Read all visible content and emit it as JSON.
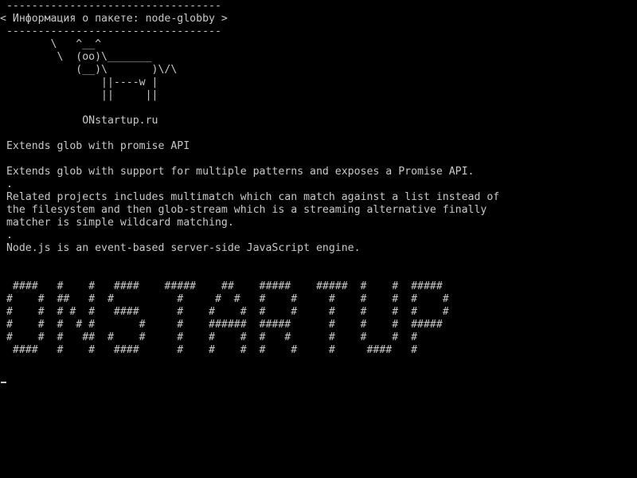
{
  "terminal": {
    "background": "#000000",
    "foreground": "#c8c8c8",
    "lines": [
      " ----------------------------------",
      "< Информация о пакете: node-globby >",
      " ----------------------------------",
      "        \\   ^__^",
      "         \\  (oo)\\_______",
      "            (__)\\       )\\/\\",
      "                ||----w |",
      "                ||     ||",
      "",
      "             ONstartup.ru",
      "",
      " Extends glob with promise API",
      "",
      " Extends glob with support for multiple patterns and exposes a Promise API.",
      " .",
      " Related projects includes multimatch which can match against a list instead of",
      " the filesystem and then glob-stream which is a streaming alternative finally",
      " matcher is simple wildcard matching.",
      " .",
      " Node.js is an event-based server-side JavaScript engine.",
      "",
      "",
      "  ####   #    #   ####    #####    ##    #####    #####  #    #  #####",
      " #    #  ##   #  #          #     #  #   #    #     #    #    #  #    #",
      " #    #  # #  #   ####      #    #    #  #    #     #    #    #  #    #",
      " #    #  #  # #       #     #    ######  #####      #    #    #  #####",
      " #    #  #   ##  #    #     #    #    #  #   #      #    #    #  #",
      "  ####   #    #   ####      #    #    #  #    #     #     ####   #"
    ]
  }
}
